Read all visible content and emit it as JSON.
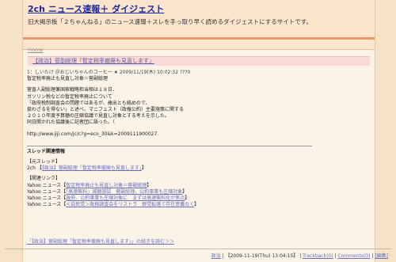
{
  "header": {
    "title_prefix": "2ch",
    "title_rest": " ニュース速報＋ ダイジェスト",
    "description": "旧大掲示板「２ちゃんねる」のニュース速報＋スレを手っ取り早く読めるダイジェストにするサイトです。"
  },
  "nav": {
    "home": "Home"
  },
  "article": {
    "title": "【政治】菅副総理「暫定税率撤廃も見直します」",
    "meta": "1：しいたけ ＠おじいちゃんのコーヒー ★ 2009/11/19(木) 10:02:32 ???0",
    "headline": "暫定税率廃止も見直し対象＝菅副総理",
    "body_lines": [
      "菅直人副総理兼国家戦略担当相は１８日、",
      "ガソリン税などの暫定税率廃止について",
      "「政府税制調査会の問題ではあるが、歳出とも絡めので、",
      "扱わざるを得ない」と述べ、マニフェスト（政権公約）主要施策に関する",
      "２０１０年度予算額の圧縮協議で見直し対象とする考えを示した。",
      "同日開かれた協議後に記者団に語った。（"
    ],
    "source_url": "http://www.jiji.com/jc/c?g=eco_30&k=2009111900027",
    "related_heading": "スレッド関連情報",
    "source_thread_label": "【元スレッド】",
    "source_thread_prefix": "2ch 【",
    "source_thread_link": "【政治】菅副総理「暫定税率撤廃も見直します」",
    "source_thread_suffix": "】",
    "related_links_label": "【関連リンク】",
    "related_links": [
      {
        "prefix": "Yahoo ニュース【",
        "text": "暫定税率廃止も見直し対象＝菅副総理",
        "suffix": "】"
      },
      {
        "prefix": "Yahoo ニュース【",
        "text": "「高速無料」減額容認　菅副総理、公約事業も圧縮対象",
        "suffix": "】"
      },
      {
        "prefix": "Yahoo ニュース【",
        "text": "政府、公約事業も圧縮対象に　まずは高速無料化が焦点",
        "suffix": "】"
      },
      {
        "prefix": "Yahoo ニュース【",
        "text": "＜自民党＞政務調査会をリストラ　野党転落で存在意義なく",
        "suffix": "】"
      }
    ],
    "read_more": "「【政治】菅副総理「暫定税率撤廃も見直します」」の続きを読む＞＞"
  },
  "footer": {
    "category": "政治",
    "separator": " | ",
    "timestamp": "【2009-11-19(Thu) 13:04:15】",
    "trackback": "Trackback(0)",
    "comments": "Comments(0)",
    "edit": "[編集]"
  }
}
